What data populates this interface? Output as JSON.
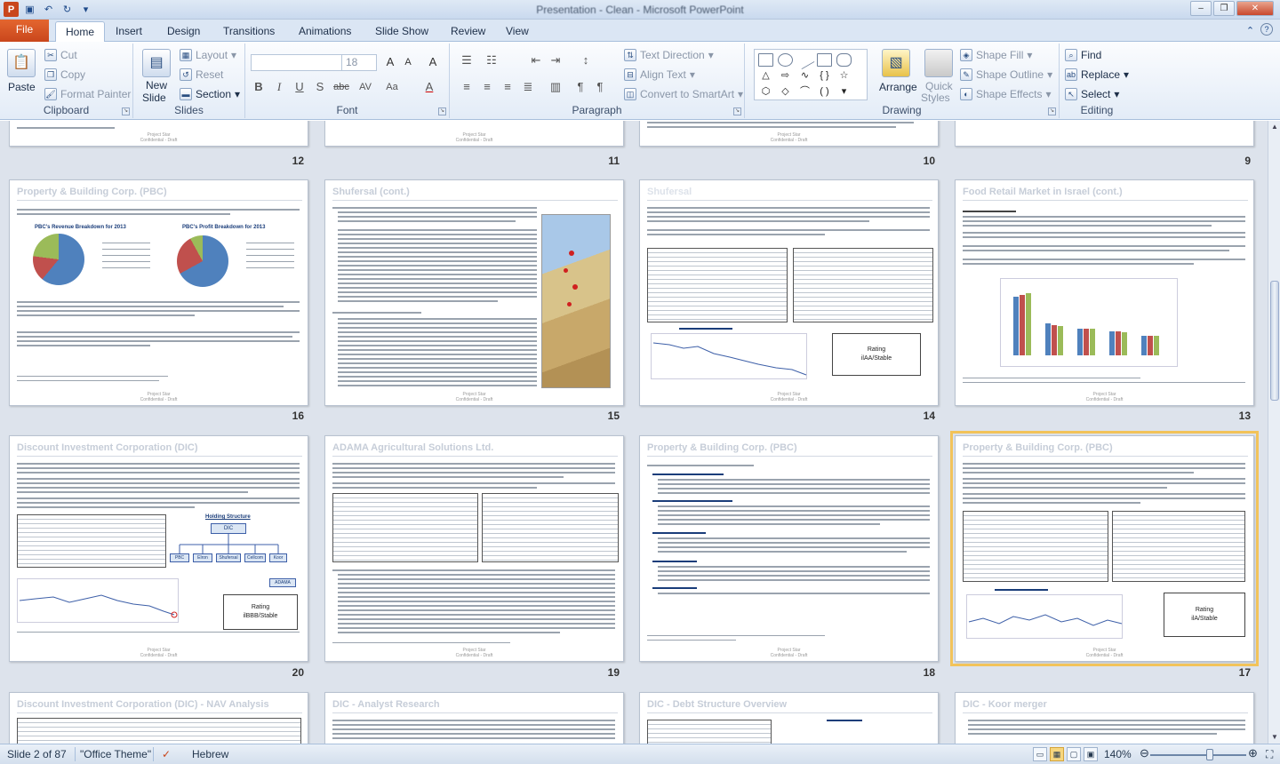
{
  "window": {
    "title": "Presentation - Clean - Microsoft PowerPoint",
    "controls": {
      "minimize": "–",
      "maximize": "❐",
      "close": "✕"
    }
  },
  "tabs": [
    {
      "label": "File"
    },
    {
      "label": "Home"
    },
    {
      "label": "Insert"
    },
    {
      "label": "Design"
    },
    {
      "label": "Transitions"
    },
    {
      "label": "Animations"
    },
    {
      "label": "Slide Show"
    },
    {
      "label": "Review"
    },
    {
      "label": "View"
    }
  ],
  "ribbon": {
    "clipboard": {
      "label": "Clipboard",
      "paste": "Paste",
      "cut": "Cut",
      "copy": "Copy",
      "format_painter": "Format Painter"
    },
    "slides": {
      "label": "Slides",
      "new_slide": "New",
      "new_slide2": "Slide",
      "layout": "Layout",
      "reset": "Reset",
      "section": "Section"
    },
    "font": {
      "label": "Font",
      "size": "18",
      "bold": "B",
      "italic": "I",
      "underline": "U",
      "shadow": "S",
      "strike": "abc",
      "spacing": "AV",
      "case": "Aa",
      "color": "A",
      "grow": "A",
      "shrink": "A",
      "clear": "A"
    },
    "paragraph": {
      "label": "Paragraph",
      "text_direction": "Text Direction",
      "align_text": "Align Text",
      "smartart": "Convert to SmartArt"
    },
    "drawing": {
      "label": "Drawing",
      "arrange": "Arrange",
      "quick_styles": "Quick",
      "quick_styles2": "Styles",
      "shape_fill": "Shape Fill",
      "shape_outline": "Shape Outline",
      "shape_effects": "Shape Effects"
    },
    "editing": {
      "label": "Editing",
      "find": "Find",
      "replace": "Replace",
      "select": "Select"
    }
  },
  "slides": {
    "row_partial_numbers": [
      "12",
      "11",
      "10",
      "9"
    ],
    "row2_numbers": [
      "16",
      "15",
      "14",
      "13"
    ],
    "row3_numbers": [
      "20",
      "19",
      "18",
      "17"
    ],
    "row2": [
      {
        "title": "Property & Building Corp. (PBC)",
        "pie1_title": "PBC's Revenue Breakdown for 2013",
        "pie2_title": "PBC's Profit Breakdown for 2013",
        "footer1": "Project Star",
        "footer2": "Confidential - Draft"
      },
      {
        "title": "Shufersal (cont.)",
        "footer1": "Project Star",
        "footer2": "Confidential - Draft"
      },
      {
        "title": "Shufersal",
        "rating_title": "Rating",
        "rating_value": "ilAA/Stable",
        "footer1": "Project Star",
        "footer2": "Confidential - Draft"
      },
      {
        "title": "Food Retail Market in Israel (cont.)",
        "footer1": "Project Star",
        "footer2": "Confidential - Draft"
      }
    ],
    "row3": [
      {
        "title": "Discount Investment Corporation (DIC)",
        "org_top": "DIC",
        "org_items": [
          "PBC",
          "Elron",
          "Shufersal",
          "Cellcom",
          "Koor"
        ],
        "org_bottom": "ADAMA",
        "org_title": "Holding Structure",
        "rating_title": "Rating",
        "rating_value": "ilBBB/Stable",
        "footer1": "Project Star",
        "footer2": "Confidential - Draft"
      },
      {
        "title": "ADAMA Agricultural Solutions Ltd.",
        "footer1": "Project Star",
        "footer2": "Confidential - Draft"
      },
      {
        "title": "Property & Building Corp. (PBC)",
        "footer1": "Project Star",
        "footer2": "Confidential - Draft"
      },
      {
        "title": "Property & Building Corp. (PBC)",
        "rating_title": "Rating",
        "rating_value": "ilA/Stable",
        "footer1": "Project Star",
        "footer2": "Confidential - Draft"
      }
    ],
    "row4": [
      {
        "title": "Discount Investment Corporation (DIC) - NAV Analysis"
      },
      {
        "title": "DIC - Analyst Research"
      },
      {
        "title": "DIC - Debt Structure Overview"
      },
      {
        "title": "DIC - Koor merger"
      }
    ]
  },
  "status": {
    "slide_info": "Slide 2 of 87",
    "theme": "\"Office Theme\"",
    "language": "Hebrew",
    "zoom": "140%",
    "zoom_fraction": 0.62
  }
}
